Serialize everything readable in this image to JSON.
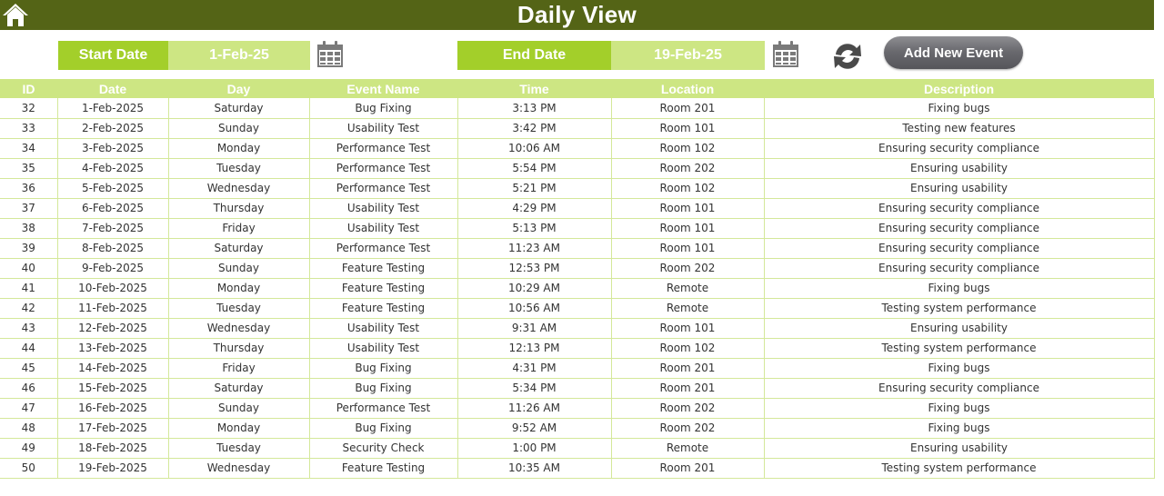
{
  "header": {
    "title": "Daily View",
    "home_icon": "home-icon"
  },
  "filters": {
    "start_date_label": "Start Date",
    "start_date_value": "1-Feb-25",
    "end_date_label": "End Date",
    "end_date_value": "19-Feb-25",
    "calendar_icon": "calendar-icon",
    "refresh_icon": "refresh-icon",
    "add_event_label": "Add New Event"
  },
  "colors": {
    "title_bar": "#546416",
    "label_green": "#a3cf2a",
    "light_green": "#cde683",
    "button_gray": "#6a6a6f"
  },
  "table": {
    "columns": [
      "ID",
      "Date",
      "Day",
      "Event Name",
      "Time",
      "Location",
      "Description"
    ],
    "rows": [
      [
        "32",
        "1-Feb-2025",
        "Saturday",
        "Bug Fixing",
        "3:13 PM",
        "Room 201",
        "Fixing bugs"
      ],
      [
        "33",
        "2-Feb-2025",
        "Sunday",
        "Usability Test",
        "3:42 PM",
        "Room 101",
        "Testing new features"
      ],
      [
        "34",
        "3-Feb-2025",
        "Monday",
        "Performance Test",
        "10:06 AM",
        "Room 102",
        "Ensuring security compliance"
      ],
      [
        "35",
        "4-Feb-2025",
        "Tuesday",
        "Performance Test",
        "5:54 PM",
        "Room 202",
        "Ensuring usability"
      ],
      [
        "36",
        "5-Feb-2025",
        "Wednesday",
        "Performance Test",
        "5:21 PM",
        "Room 102",
        "Ensuring usability"
      ],
      [
        "37",
        "6-Feb-2025",
        "Thursday",
        "Usability Test",
        "4:29 PM",
        "Room 101",
        "Ensuring security compliance"
      ],
      [
        "38",
        "7-Feb-2025",
        "Friday",
        "Usability Test",
        "5:13 PM",
        "Room 101",
        "Ensuring security compliance"
      ],
      [
        "39",
        "8-Feb-2025",
        "Saturday",
        "Performance Test",
        "11:23 AM",
        "Room 101",
        "Ensuring security compliance"
      ],
      [
        "40",
        "9-Feb-2025",
        "Sunday",
        "Feature Testing",
        "12:53 PM",
        "Room 202",
        "Ensuring security compliance"
      ],
      [
        "41",
        "10-Feb-2025",
        "Monday",
        "Feature Testing",
        "10:29 AM",
        "Remote",
        "Fixing bugs"
      ],
      [
        "42",
        "11-Feb-2025",
        "Tuesday",
        "Feature Testing",
        "10:56 AM",
        "Remote",
        "Testing system performance"
      ],
      [
        "43",
        "12-Feb-2025",
        "Wednesday",
        "Usability Test",
        "9:31 AM",
        "Room 101",
        "Ensuring usability"
      ],
      [
        "44",
        "13-Feb-2025",
        "Thursday",
        "Usability Test",
        "12:13 PM",
        "Room 102",
        "Testing system performance"
      ],
      [
        "45",
        "14-Feb-2025",
        "Friday",
        "Bug Fixing",
        "4:31 PM",
        "Room 201",
        "Fixing bugs"
      ],
      [
        "46",
        "15-Feb-2025",
        "Saturday",
        "Bug Fixing",
        "5:34 PM",
        "Room 201",
        "Ensuring security compliance"
      ],
      [
        "47",
        "16-Feb-2025",
        "Sunday",
        "Performance Test",
        "11:26 AM",
        "Room 202",
        "Fixing bugs"
      ],
      [
        "48",
        "17-Feb-2025",
        "Monday",
        "Bug Fixing",
        "9:52 AM",
        "Room 202",
        "Fixing bugs"
      ],
      [
        "49",
        "18-Feb-2025",
        "Tuesday",
        "Security Check",
        "1:00 PM",
        "Remote",
        "Ensuring usability"
      ],
      [
        "50",
        "19-Feb-2025",
        "Wednesday",
        "Feature Testing",
        "10:35 AM",
        "Room 201",
        "Testing system performance"
      ]
    ]
  }
}
